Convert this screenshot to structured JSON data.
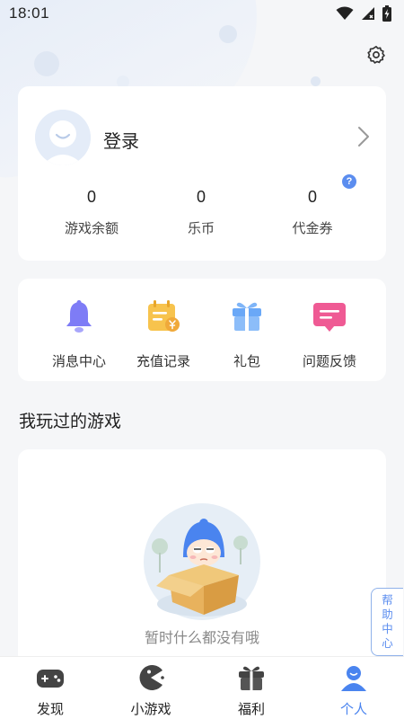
{
  "status_bar": {
    "time": "18:01"
  },
  "profile": {
    "login_label": "登录",
    "stats": [
      {
        "value": "0",
        "label": "游戏余额"
      },
      {
        "value": "0",
        "label": "乐币"
      },
      {
        "value": "0",
        "label": "代金券"
      }
    ],
    "help_badge": "?"
  },
  "features": [
    {
      "label": "消息中心",
      "icon": "bell-icon"
    },
    {
      "label": "充值记录",
      "icon": "recharge-record-icon"
    },
    {
      "label": "礼包",
      "icon": "gift-icon"
    },
    {
      "label": "问题反馈",
      "icon": "feedback-icon"
    }
  ],
  "played_games": {
    "title": "我玩过的游戏",
    "empty_text": "暂时什么都没有哦"
  },
  "help_center": {
    "label": "帮助中心"
  },
  "tabs": [
    {
      "label": "发现",
      "icon": "gamepad-icon",
      "active": false
    },
    {
      "label": "小游戏",
      "icon": "pacman-icon",
      "active": false
    },
    {
      "label": "福利",
      "icon": "gift-icon",
      "active": false
    },
    {
      "label": "个人",
      "icon": "person-icon",
      "active": true
    }
  ],
  "colors": {
    "accent": "#4a84ef",
    "background": "#f5f6f8",
    "card": "#ffffff"
  }
}
